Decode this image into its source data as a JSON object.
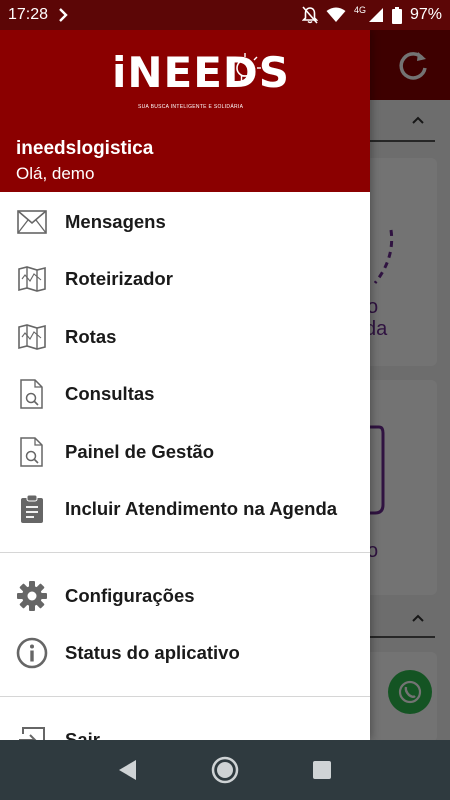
{
  "status_bar": {
    "time": "17:28",
    "network": "4G",
    "battery": "97%"
  },
  "drawer": {
    "logo_text": "iNEEDS",
    "logo_tagline": "SUA BUSCA INTELIGENTE E SOLIDÁRIA",
    "app_name": "ineedslogistica",
    "greeting": "Olá, demo",
    "menu_items": [
      {
        "label": "Mensagens",
        "icon": "mail-icon"
      },
      {
        "label": "Roteirizador",
        "icon": "map-icon"
      },
      {
        "label": "Rotas",
        "icon": "map-icon"
      },
      {
        "label": "Consultas",
        "icon": "document-search-icon"
      },
      {
        "label": "Painel de Gestão",
        "icon": "document-search-icon"
      },
      {
        "label": "Incluir Atendimento na Agenda",
        "icon": "clipboard-icon"
      }
    ],
    "settings_items": [
      {
        "label": "Configurações",
        "icon": "gear-icon"
      },
      {
        "label": "Status do aplicativo",
        "icon": "info-icon"
      }
    ],
    "footer_items": [
      {
        "label": "Sair",
        "icon": "logout-icon"
      }
    ]
  },
  "background": {
    "card_text_1": "o",
    "card_text_2": "da",
    "card_text_3": "o"
  },
  "colors": {
    "header": "#8b0000",
    "status_bar": "#5c0606",
    "accent_purple": "#6a2c91",
    "whatsapp": "#2dbb4f"
  }
}
